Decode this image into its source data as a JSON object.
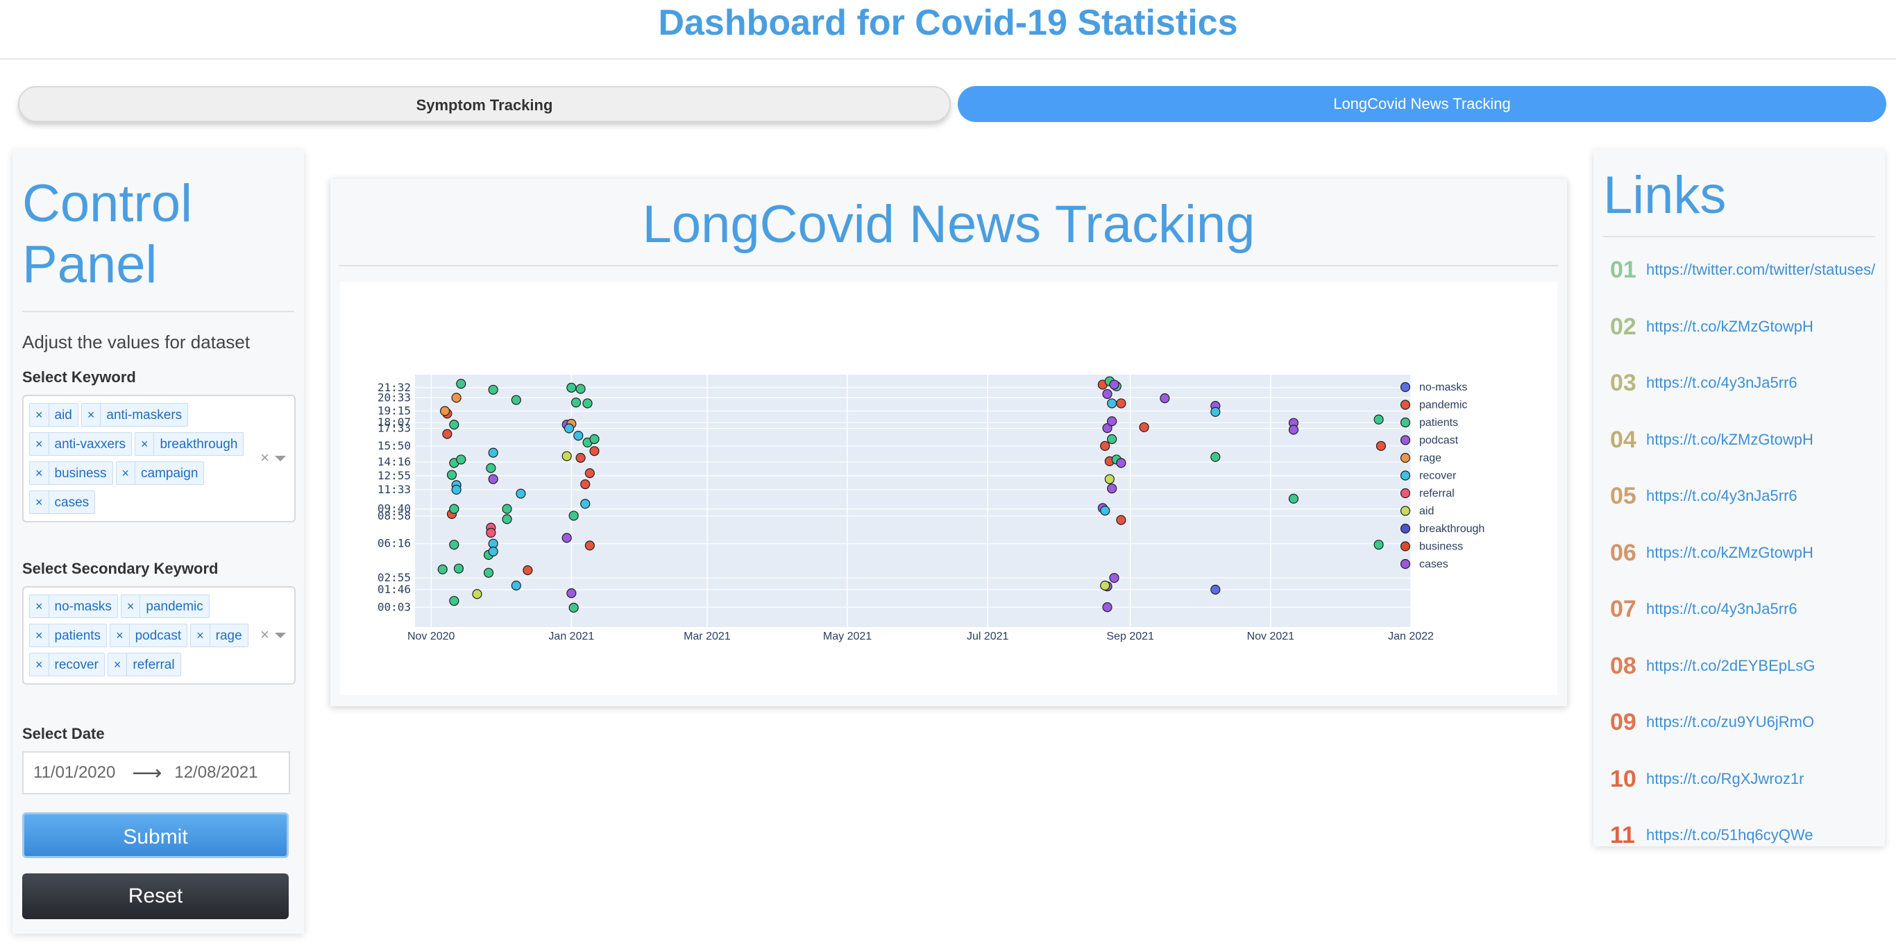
{
  "header": {
    "title": "Dashboard for Covid-19 Statistics"
  },
  "tabs": [
    {
      "label": "Symptom Tracking",
      "active": false
    },
    {
      "label": "LongCovid News Tracking",
      "active": true
    }
  ],
  "control_panel": {
    "title": "Control Panel",
    "subtitle": "Adjust the values for dataset",
    "keyword_label": "Select Keyword",
    "keywords": [
      "aid",
      "anti-maskers",
      "anti-vaxxers",
      "breakthrough",
      "business",
      "campaign",
      "cases"
    ],
    "secondary_label": "Select Secondary Keyword",
    "secondary_keywords": [
      "no-masks",
      "pandemic",
      "patients",
      "podcast",
      "rage",
      "recover",
      "referral"
    ],
    "date_label": "Select Date",
    "date_start": "11/01/2020",
    "date_end": "12/08/2021",
    "submit_label": "Submit",
    "reset_label": "Reset"
  },
  "main": {
    "title": "LongCovid News Tracking"
  },
  "links": {
    "title": "Links",
    "items": [
      {
        "num": "01",
        "url": "https://twitter.com/twitter/statuses/",
        "color": "#8fc99a"
      },
      {
        "num": "02",
        "url": "https://t.co/kZMzGtowpH",
        "color": "#a9c08a"
      },
      {
        "num": "03",
        "url": "https://t.co/4y3nJa5rr6",
        "color": "#b8b87e"
      },
      {
        "num": "04",
        "url": "https://t.co/kZMzGtowpH",
        "color": "#c2ad78"
      },
      {
        "num": "05",
        "url": "https://t.co/4y3nJa5rr6",
        "color": "#cba270"
      },
      {
        "num": "06",
        "url": "https://t.co/kZMzGtowpH",
        "color": "#d3956a"
      },
      {
        "num": "07",
        "url": "https://t.co/4y3nJa5rr6",
        "color": "#d98a62"
      },
      {
        "num": "08",
        "url": "https://t.co/2dEYBEpLsG",
        "color": "#de7e58"
      },
      {
        "num": "09",
        "url": "https://t.co/zu9YU6jRmO",
        "color": "#e07350"
      },
      {
        "num": "10",
        "url": "https://t.co/RgXJwroz1r",
        "color": "#e06a48"
      },
      {
        "num": "11",
        "url": "https://t.co/51hq6cyQWe",
        "color": "#e06242"
      }
    ]
  },
  "chart_data": {
    "type": "scatter",
    "title": "",
    "xlabel": "",
    "ylabel": "",
    "x_ticks": [
      "Nov 2020",
      "Jan 2021",
      "Mar 2021",
      "May 2021",
      "Jul 2021",
      "Sep 2021",
      "Nov 2021",
      "Jan 2022"
    ],
    "y_ticks": [
      "00:03",
      "01:46",
      "02:55",
      "06:16",
      "08:58",
      "09:40",
      "11:33",
      "12:55",
      "14:16",
      "15:50",
      "17:33",
      "18:07",
      "19:15",
      "20:33",
      "21:32"
    ],
    "xlim": [
      "2020-10-25",
      "2022-01-01"
    ],
    "ylim": [
      "23:59",
      "22:00"
    ],
    "legend_placement": "right",
    "series": [
      {
        "name": "no-masks",
        "color": "#5b6ee8",
        "points": [
          [
            "2021-10-08",
            "01:46"
          ]
        ]
      },
      {
        "name": "pandemic",
        "color": "#e4543e",
        "points": [
          [
            "2020-11-08",
            "19:00"
          ],
          [
            "2020-11-08",
            "17:00"
          ],
          [
            "2020-11-10",
            "09:10"
          ],
          [
            "2020-12-13",
            "03:40"
          ],
          [
            "2021-01-05",
            "14:40"
          ],
          [
            "2021-01-07",
            "12:05"
          ],
          [
            "2021-01-09",
            "13:10"
          ],
          [
            "2021-01-11",
            "15:20"
          ],
          [
            "2021-01-09",
            "06:05"
          ],
          [
            "2021-08-20",
            "21:50"
          ],
          [
            "2021-08-21",
            "15:50"
          ],
          [
            "2021-08-23",
            "14:20"
          ],
          [
            "2021-08-28",
            "20:00"
          ],
          [
            "2021-08-28",
            "08:35"
          ],
          [
            "2021-09-07",
            "17:40"
          ],
          [
            "2021-12-19",
            "15:50"
          ]
        ]
      },
      {
        "name": "patients",
        "color": "#3cc88a",
        "points": [
          [
            "2020-11-14",
            "21:55"
          ],
          [
            "2020-11-06",
            "03:45"
          ],
          [
            "2020-11-11",
            "17:55"
          ],
          [
            "2020-11-11",
            "14:10"
          ],
          [
            "2020-11-14",
            "14:30"
          ],
          [
            "2020-11-10",
            "13:00"
          ],
          [
            "2020-11-11",
            "09:40"
          ],
          [
            "2020-11-11",
            "06:10"
          ],
          [
            "2020-11-13",
            "03:50"
          ],
          [
            "2020-11-11",
            "00:40"
          ],
          [
            "2020-11-28",
            "21:20"
          ],
          [
            "2020-11-27",
            "13:40"
          ],
          [
            "2020-11-26",
            "05:10"
          ],
          [
            "2020-11-26",
            "03:25"
          ],
          [
            "2020-12-04",
            "09:40"
          ],
          [
            "2020-12-04",
            "08:40"
          ],
          [
            "2020-12-08",
            "20:20"
          ],
          [
            "2021-01-01",
            "21:32"
          ],
          [
            "2021-01-05",
            "21:25"
          ],
          [
            "2021-01-03",
            "20:05"
          ],
          [
            "2021-01-08",
            "20:00"
          ],
          [
            "2021-01-08",
            "16:10"
          ],
          [
            "2021-01-11",
            "16:30"
          ],
          [
            "2021-01-02",
            "09:00"
          ],
          [
            "2021-01-02",
            "00:00"
          ],
          [
            "2021-08-23",
            "22:10"
          ],
          [
            "2021-08-26",
            "21:40"
          ],
          [
            "2021-08-24",
            "16:30"
          ],
          [
            "2021-08-26",
            "14:30"
          ],
          [
            "2021-10-08",
            "14:45"
          ],
          [
            "2021-11-11",
            "10:40"
          ],
          [
            "2021-12-18",
            "18:25"
          ],
          [
            "2021-12-18",
            "06:10"
          ]
        ]
      },
      {
        "name": "podcast",
        "color": "#9b5ae0",
        "points": [
          [
            "2020-11-28",
            "12:35"
          ],
          [
            "2020-12-30",
            "17:55"
          ],
          [
            "2020-12-30",
            "06:50"
          ],
          [
            "2021-01-01",
            "01:25"
          ],
          [
            "2021-08-22",
            "20:55"
          ],
          [
            "2021-08-25",
            "21:50"
          ],
          [
            "2021-08-22",
            "17:35"
          ],
          [
            "2021-08-24",
            "18:15"
          ],
          [
            "2021-08-28",
            "14:10"
          ],
          [
            "2021-08-24",
            "11:40"
          ],
          [
            "2021-08-20",
            "09:45"
          ],
          [
            "2021-08-25",
            "02:55"
          ],
          [
            "2021-08-22",
            "02:05"
          ],
          [
            "2021-08-22",
            "00:03"
          ],
          [
            "2021-09-16",
            "20:30"
          ],
          [
            "2021-10-08",
            "19:45"
          ],
          [
            "2021-11-11",
            "18:05"
          ],
          [
            "2021-11-11",
            "17:25"
          ]
        ]
      },
      {
        "name": "rage",
        "color": "#f0944a",
        "points": [
          [
            "2020-11-07",
            "19:15"
          ],
          [
            "2020-11-12",
            "20:33"
          ],
          [
            "2021-01-01",
            "18:00"
          ]
        ]
      },
      {
        "name": "recover",
        "color": "#3cc0e4",
        "points": [
          [
            "2020-11-12",
            "12:00"
          ],
          [
            "2020-11-12",
            "11:33"
          ],
          [
            "2020-11-28",
            "15:10"
          ],
          [
            "2020-11-28",
            "06:16"
          ],
          [
            "2020-11-28",
            "05:30"
          ],
          [
            "2020-12-10",
            "11:10"
          ],
          [
            "2020-12-08",
            "02:10"
          ],
          [
            "2020-12-31",
            "17:33"
          ],
          [
            "2021-01-04",
            "16:50"
          ],
          [
            "2021-01-07",
            "10:10"
          ],
          [
            "2021-08-24",
            "20:00"
          ],
          [
            "2021-08-21",
            "09:30"
          ],
          [
            "2021-10-08",
            "19:10"
          ]
        ]
      },
      {
        "name": "referral",
        "color": "#ec5a78",
        "points": [
          [
            "2020-11-27",
            "07:50"
          ],
          [
            "2020-11-27",
            "07:20"
          ]
        ]
      },
      {
        "name": "aid",
        "color": "#c8dc5a",
        "points": [
          [
            "2020-11-21",
            "01:20"
          ],
          [
            "2020-12-30",
            "14:50"
          ],
          [
            "2021-08-23",
            "12:35"
          ],
          [
            "2021-08-21",
            "02:10"
          ]
        ]
      },
      {
        "name": "breakthrough",
        "color": "#4a55c8",
        "points": []
      },
      {
        "name": "business",
        "color": "#d94a2e",
        "points": []
      },
      {
        "name": "cases",
        "color": "#a055e0",
        "points": []
      }
    ]
  }
}
